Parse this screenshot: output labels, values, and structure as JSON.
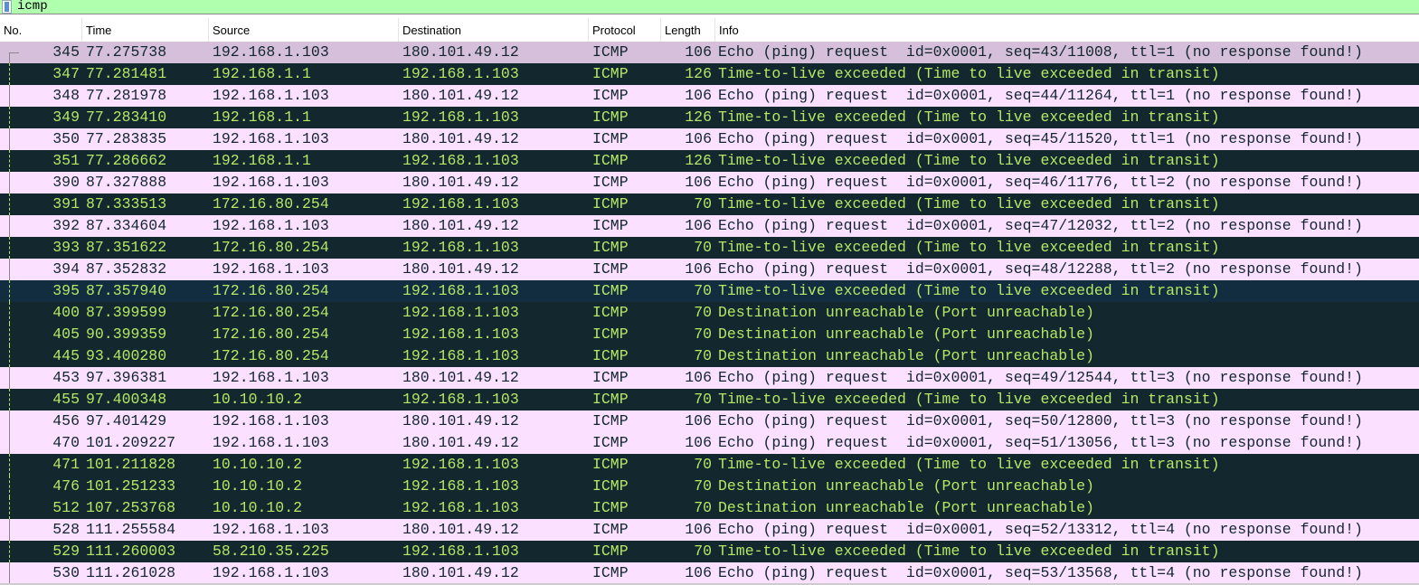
{
  "filter": {
    "value": "icmp"
  },
  "columns": [
    "No.",
    "Time",
    "Source",
    "Destination",
    "Protocol",
    "Length",
    "Info"
  ],
  "colors": {
    "request_bg": "#fce0ff",
    "error_bg": "#12272e",
    "error_fg": "#b5e765",
    "filter_bg": "#afffaf",
    "selected_bg": "#d6bfda"
  },
  "packets": [
    {
      "no": "345",
      "time": "77.275738",
      "src": "192.168.1.103",
      "dst": "180.101.49.12",
      "proto": "ICMP",
      "len": "106",
      "info": "Echo (ping) request  id=0x0001, seq=43/11008, ttl=1 (no response found!)",
      "type": "req",
      "selected": true
    },
    {
      "no": "347",
      "time": "77.281481",
      "src": "192.168.1.1",
      "dst": "192.168.1.103",
      "proto": "ICMP",
      "len": "126",
      "info": "Time-to-live exceeded (Time to live exceeded in transit)",
      "type": "ttl"
    },
    {
      "no": "348",
      "time": "77.281978",
      "src": "192.168.1.103",
      "dst": "180.101.49.12",
      "proto": "ICMP",
      "len": "106",
      "info": "Echo (ping) request  id=0x0001, seq=44/11264, ttl=1 (no response found!)",
      "type": "req"
    },
    {
      "no": "349",
      "time": "77.283410",
      "src": "192.168.1.1",
      "dst": "192.168.1.103",
      "proto": "ICMP",
      "len": "126",
      "info": "Time-to-live exceeded (Time to live exceeded in transit)",
      "type": "ttl"
    },
    {
      "no": "350",
      "time": "77.283835",
      "src": "192.168.1.103",
      "dst": "180.101.49.12",
      "proto": "ICMP",
      "len": "106",
      "info": "Echo (ping) request  id=0x0001, seq=45/11520, ttl=1 (no response found!)",
      "type": "req"
    },
    {
      "no": "351",
      "time": "77.286662",
      "src": "192.168.1.1",
      "dst": "192.168.1.103",
      "proto": "ICMP",
      "len": "126",
      "info": "Time-to-live exceeded (Time to live exceeded in transit)",
      "type": "ttl"
    },
    {
      "no": "390",
      "time": "87.327888",
      "src": "192.168.1.103",
      "dst": "180.101.49.12",
      "proto": "ICMP",
      "len": "106",
      "info": "Echo (ping) request  id=0x0001, seq=46/11776, ttl=2 (no response found!)",
      "type": "req"
    },
    {
      "no": "391",
      "time": "87.333513",
      "src": "172.16.80.254",
      "dst": "192.168.1.103",
      "proto": "ICMP",
      "len": "70",
      "info": "Time-to-live exceeded (Time to live exceeded in transit)",
      "type": "ttl"
    },
    {
      "no": "392",
      "time": "87.334604",
      "src": "192.168.1.103",
      "dst": "180.101.49.12",
      "proto": "ICMP",
      "len": "106",
      "info": "Echo (ping) request  id=0x0001, seq=47/12032, ttl=2 (no response found!)",
      "type": "req"
    },
    {
      "no": "393",
      "time": "87.351622",
      "src": "172.16.80.254",
      "dst": "192.168.1.103",
      "proto": "ICMP",
      "len": "70",
      "info": "Time-to-live exceeded (Time to live exceeded in transit)",
      "type": "ttl"
    },
    {
      "no": "394",
      "time": "87.352832",
      "src": "192.168.1.103",
      "dst": "180.101.49.12",
      "proto": "ICMP",
      "len": "106",
      "info": "Echo (ping) request  id=0x0001, seq=48/12288, ttl=2 (no response found!)",
      "type": "req"
    },
    {
      "no": "395",
      "time": "87.357940",
      "src": "172.16.80.254",
      "dst": "192.168.1.103",
      "proto": "ICMP",
      "len": "70",
      "info": "Time-to-live exceeded (Time to live exceeded in transit)",
      "type": "ttl",
      "hover": true
    },
    {
      "no": "400",
      "time": "87.399599",
      "src": "172.16.80.254",
      "dst": "192.168.1.103",
      "proto": "ICMP",
      "len": "70",
      "info": "Destination unreachable (Port unreachable)",
      "type": "unr"
    },
    {
      "no": "405",
      "time": "90.399359",
      "src": "172.16.80.254",
      "dst": "192.168.1.103",
      "proto": "ICMP",
      "len": "70",
      "info": "Destination unreachable (Port unreachable)",
      "type": "unr"
    },
    {
      "no": "445",
      "time": "93.400280",
      "src": "172.16.80.254",
      "dst": "192.168.1.103",
      "proto": "ICMP",
      "len": "70",
      "info": "Destination unreachable (Port unreachable)",
      "type": "unr"
    },
    {
      "no": "453",
      "time": "97.396381",
      "src": "192.168.1.103",
      "dst": "180.101.49.12",
      "proto": "ICMP",
      "len": "106",
      "info": "Echo (ping) request  id=0x0001, seq=49/12544, ttl=3 (no response found!)",
      "type": "req"
    },
    {
      "no": "455",
      "time": "97.400348",
      "src": "10.10.10.2",
      "dst": "192.168.1.103",
      "proto": "ICMP",
      "len": "70",
      "info": "Time-to-live exceeded (Time to live exceeded in transit)",
      "type": "ttl"
    },
    {
      "no": "456",
      "time": "97.401429",
      "src": "192.168.1.103",
      "dst": "180.101.49.12",
      "proto": "ICMP",
      "len": "106",
      "info": "Echo (ping) request  id=0x0001, seq=50/12800, ttl=3 (no response found!)",
      "type": "req"
    },
    {
      "no": "470",
      "time": "101.209227",
      "src": "192.168.1.103",
      "dst": "180.101.49.12",
      "proto": "ICMP",
      "len": "106",
      "info": "Echo (ping) request  id=0x0001, seq=51/13056, ttl=3 (no response found!)",
      "type": "req"
    },
    {
      "no": "471",
      "time": "101.211828",
      "src": "10.10.10.2",
      "dst": "192.168.1.103",
      "proto": "ICMP",
      "len": "70",
      "info": "Time-to-live exceeded (Time to live exceeded in transit)",
      "type": "ttl"
    },
    {
      "no": "476",
      "time": "101.251233",
      "src": "10.10.10.2",
      "dst": "192.168.1.103",
      "proto": "ICMP",
      "len": "70",
      "info": "Destination unreachable (Port unreachable)",
      "type": "unr"
    },
    {
      "no": "512",
      "time": "107.253768",
      "src": "10.10.10.2",
      "dst": "192.168.1.103",
      "proto": "ICMP",
      "len": "70",
      "info": "Destination unreachable (Port unreachable)",
      "type": "unr"
    },
    {
      "no": "528",
      "time": "111.255584",
      "src": "192.168.1.103",
      "dst": "180.101.49.12",
      "proto": "ICMP",
      "len": "106",
      "info": "Echo (ping) request  id=0x0001, seq=52/13312, ttl=4 (no response found!)",
      "type": "req"
    },
    {
      "no": "529",
      "time": "111.260003",
      "src": "58.210.35.225",
      "dst": "192.168.1.103",
      "proto": "ICMP",
      "len": "70",
      "info": "Time-to-live exceeded (Time to live exceeded in transit)",
      "type": "ttl"
    },
    {
      "no": "530",
      "time": "111.261028",
      "src": "192.168.1.103",
      "dst": "180.101.49.12",
      "proto": "ICMP",
      "len": "106",
      "info": "Echo (ping) request  id=0x0001, seq=53/13568, ttl=4 (no response found!)",
      "type": "req"
    }
  ]
}
